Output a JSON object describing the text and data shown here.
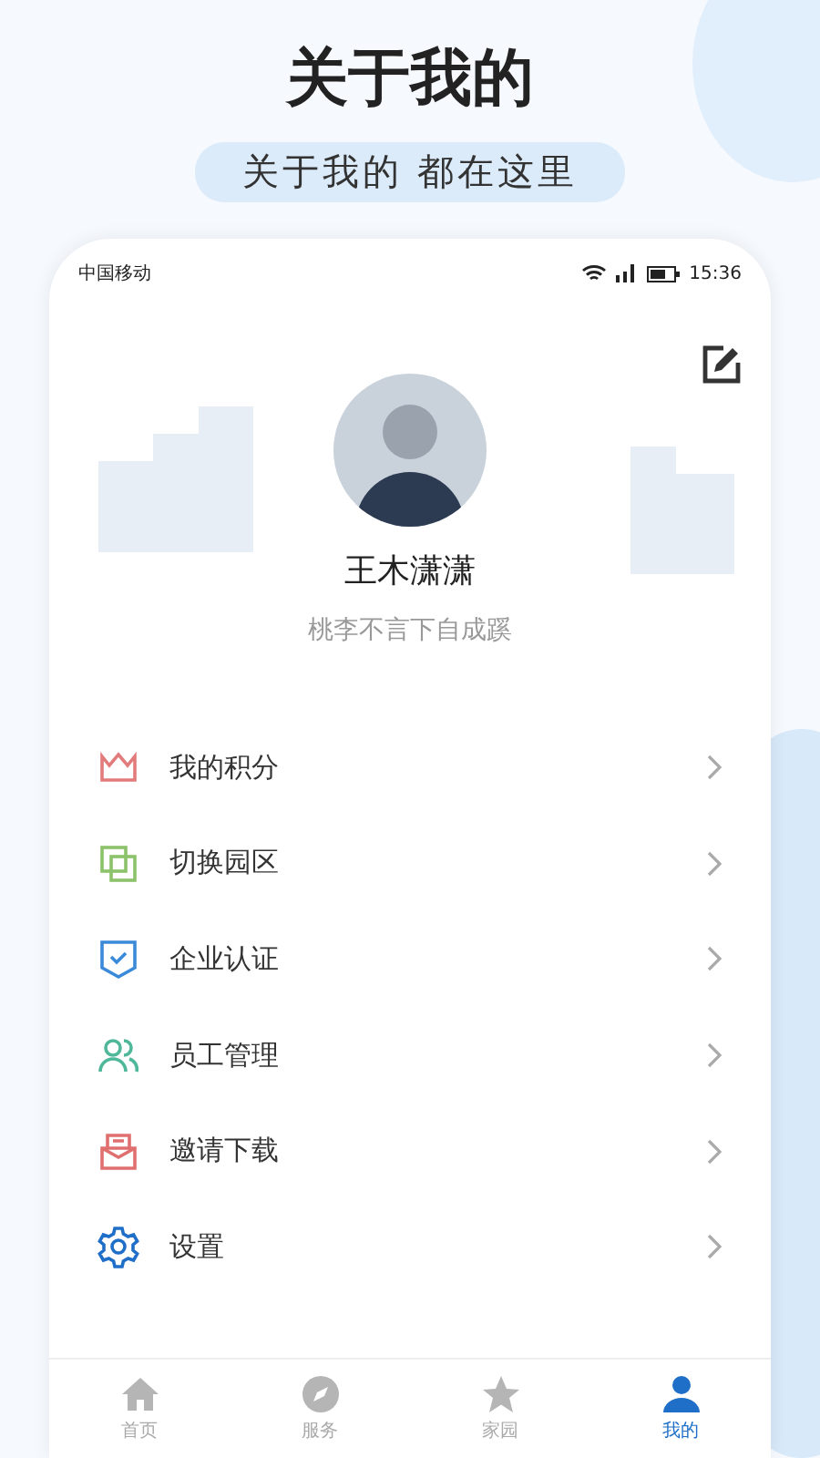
{
  "headline": "关于我的",
  "subtitle": "关于我的 都在这里",
  "status_bar": {
    "carrier": "中国移动",
    "time": "15:36"
  },
  "profile": {
    "name": "王木潇潇",
    "motto": "桃李不言下自成蹊"
  },
  "menu": [
    {
      "kind": "crown",
      "label": "我的积分",
      "color": "#e27b7b"
    },
    {
      "kind": "layers",
      "label": "切换园区",
      "color": "#8cc26a"
    },
    {
      "kind": "shield",
      "label": "企业认证",
      "color": "#3b8ad9"
    },
    {
      "kind": "people",
      "label": "员工管理",
      "color": "#4fb79a"
    },
    {
      "kind": "mail",
      "label": "邀请下载",
      "color": "#e07070"
    },
    {
      "kind": "gear",
      "label": "设置",
      "color": "#1f6fc8"
    }
  ],
  "tabs": [
    {
      "kind": "home",
      "label": "首页",
      "selected": false
    },
    {
      "kind": "compass",
      "label": "服务",
      "selected": false
    },
    {
      "kind": "star",
      "label": "家园",
      "selected": false
    },
    {
      "kind": "person",
      "label": "我的",
      "selected": true
    }
  ]
}
